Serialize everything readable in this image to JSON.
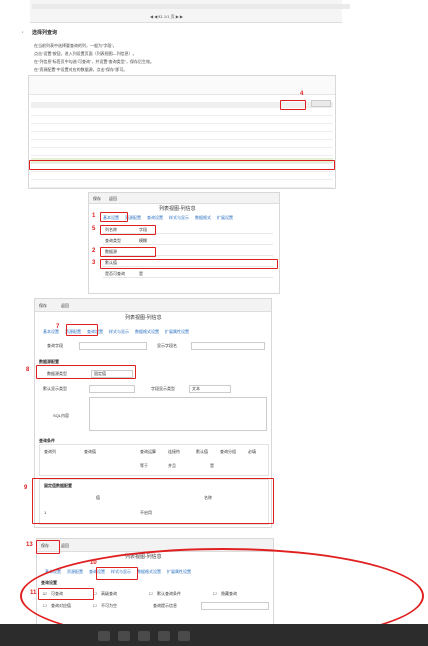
{
  "pager": {
    "text": "◀ ◀  €1  1/1 页  ▶ ▶"
  },
  "section": {
    "bullet": "·",
    "title": "选择列查询",
    "steps": [
      "在当前列表中选择要查询的列，一般为“字段”。",
      "点击“设置”按钮，进入列设置页面（列表视图—列信息）。",
      "在“列信息”标签页中勾选“可查询”，并设置“查询类型”，保存后生效。",
      "在“资源配置”中设置对应的数据源，点击“保存”即可。"
    ]
  },
  "toolbar1": {
    "items": [
      "保存",
      "返回"
    ]
  },
  "form1": {
    "title": "列表视图-列信息",
    "tabs": [
      "基本设置",
      "资源配置",
      "查询设置",
      "样式与显示",
      "数据格式",
      "扩展设置"
    ],
    "fields": [
      {
        "label": "列名称",
        "value": "字段"
      },
      {
        "label": "查询类型",
        "value": "模糊"
      },
      {
        "label": "数据源",
        "value": ""
      },
      {
        "label": "默认值",
        "value": ""
      },
      {
        "label": "是否可查询",
        "value": "是"
      }
    ]
  },
  "panel2": {
    "toolbar": [
      "保存",
      "返回"
    ],
    "title": "列表视图-列信息",
    "tabs": [
      "基本设置",
      "资源配置",
      "查询设置",
      "样式与显示",
      "数据格式设置",
      "扩展属性设置"
    ],
    "query_label": "查询字段",
    "display_label": "显示字段名",
    "config_header": "数据源配置",
    "source_type_label": "数据源类型",
    "source_type_value": "固定值",
    "field1_label": "默认显示类型",
    "field2_label": "字段显示类型",
    "field2_value": "文本",
    "content_label": "SQL内容",
    "query_header": "查询条件",
    "grid_headers": [
      "查询列",
      "查询值",
      "查询运算",
      "连接符",
      "默认值",
      "查询分组",
      "必填"
    ],
    "grid_values": [
      "等于",
      "并且",
      "是"
    ],
    "fixed_header": "固定值数据配置",
    "fixed_cols": [
      "值",
      "名称"
    ],
    "fixed_row": [
      "1",
      "不启用"
    ]
  },
  "panel3": {
    "toolbar": [
      "保存",
      "返回"
    ],
    "title": "列表视图-列信息",
    "tabs": [
      "基本设置",
      "资源配置",
      "查询设置",
      "样式与显示",
      "数据格式设置",
      "扩展属性设置"
    ],
    "group_header": "查询设置",
    "checks": [
      {
        "label": "可查询",
        "checked": true
      },
      {
        "label": "高级查询",
        "checked": false
      },
      {
        "label": "默认查询条件",
        "checked": false
      },
      {
        "label": "隐藏查询",
        "checked": false
      },
      {
        "label": "查询对应值",
        "checked": false
      },
      {
        "label": "不可为空",
        "checked": false
      }
    ],
    "extra_label": "查询提示信息"
  },
  "annotations": [
    "4",
    "1",
    "5",
    "2",
    "3",
    "7",
    "8",
    "9",
    "13",
    "10",
    "11"
  ],
  "colors": {
    "accent": "#2a6fc0",
    "annotation": "#e02020",
    "taskbar": "#2c2c2c"
  }
}
